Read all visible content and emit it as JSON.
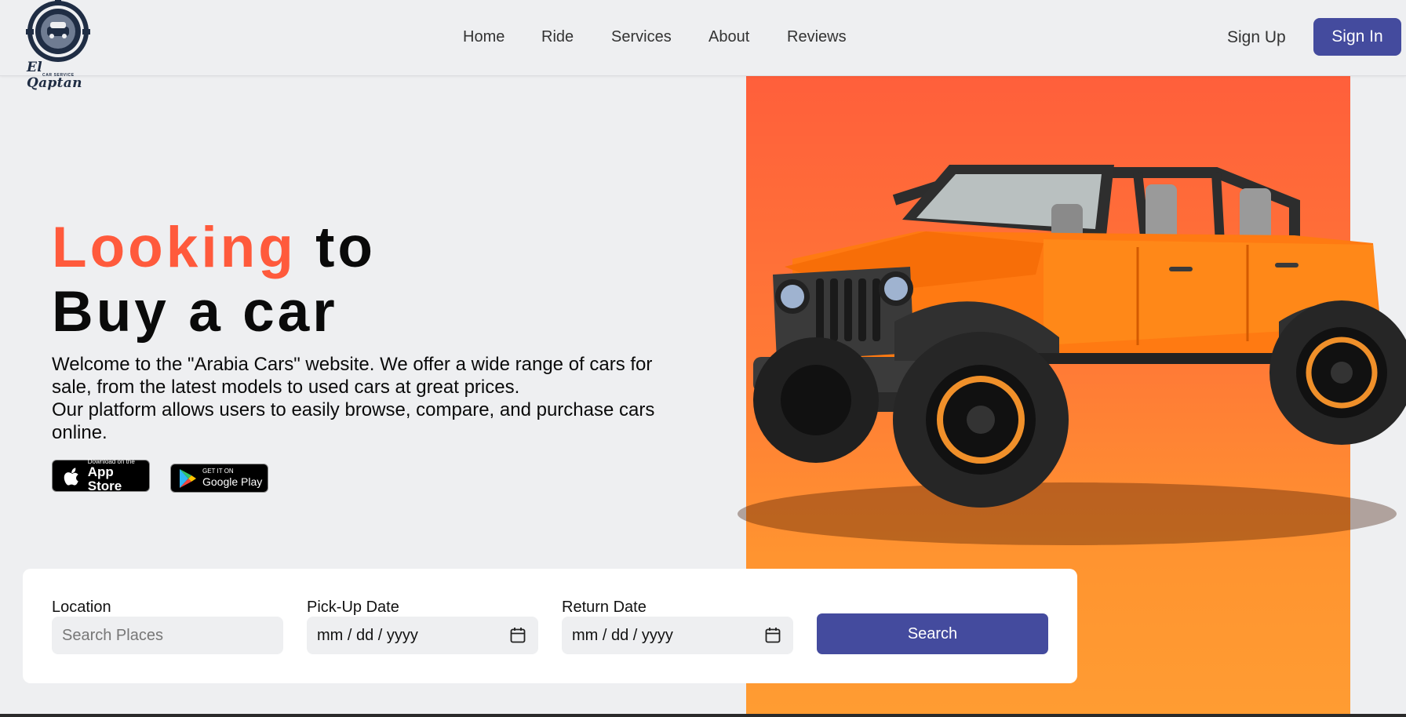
{
  "brand": {
    "name": "El Qaptan",
    "tagline": "CAR SERVICE"
  },
  "nav": {
    "items": [
      {
        "label": "Home"
      },
      {
        "label": "Ride"
      },
      {
        "label": "Services"
      },
      {
        "label": "About"
      },
      {
        "label": "Reviews"
      }
    ],
    "sign_up": "Sign Up",
    "sign_in": "Sign In"
  },
  "hero": {
    "headline_accent": "Looking",
    "headline_rest": " to",
    "headline_line2": "Buy a car",
    "paragraph1": "Welcome to the \"Arabia Cars\" website. We offer a wide range of cars for sale, from the latest models to used cars at great prices.",
    "paragraph2": "Our platform allows users to easily browse, compare, and purchase cars online.",
    "app_store": {
      "small": "Download on the",
      "big": "App Store"
    },
    "google_play": {
      "small": "GET IT ON",
      "big": "Google Play"
    }
  },
  "search": {
    "location_label": "Location",
    "location_placeholder": "Search Places",
    "pickup_label": "Pick-Up Date",
    "pickup_value": "mm / dd / yyyy",
    "return_label": "Return Date",
    "return_value": "mm / dd / yyyy",
    "button": "Search"
  },
  "colors": {
    "accent": "#ff5a3c",
    "primary": "#444b9e",
    "background": "#eeeff1",
    "panel_top": "#ff5f3b",
    "panel_bottom": "#ff9c32"
  },
  "icons": [
    "logo-emblem",
    "calendar-icon",
    "apple-icon",
    "google-play-icon"
  ]
}
